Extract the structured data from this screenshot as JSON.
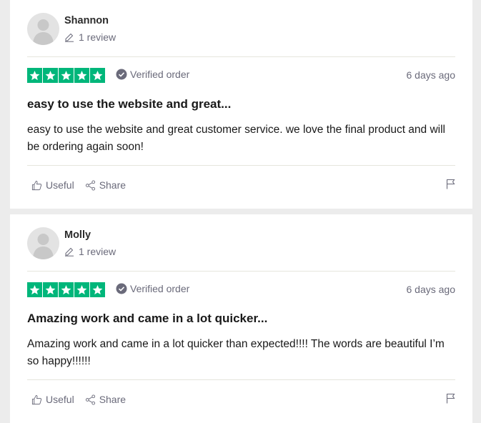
{
  "reviews": [
    {
      "author": "Shannon",
      "review_count": "1 review",
      "verified_label": "Verified order",
      "date": "6 days ago",
      "title": "easy to use the website and great...",
      "body": "easy to use the website and great customer service. we love the final product and will be ordering again soon!",
      "rating": 5,
      "useful_label": "Useful",
      "share_label": "Share"
    },
    {
      "author": "Molly",
      "review_count": "1 review",
      "verified_label": "Verified order",
      "date": "6 days ago",
      "title": "Amazing work and came in a lot quicker...",
      "body": "Amazing work and came in a lot quicker than expected!!!! The words are beautiful I’m so happy!!!!!!",
      "rating": 5,
      "useful_label": "Useful",
      "share_label": "Share"
    }
  ],
  "colors": {
    "star_green": "#00b67a",
    "text_primary": "#191919",
    "text_muted": "#6a6a7a",
    "page_bg": "#ececec"
  },
  "icons": [
    "avatar-placeholder",
    "pencil-icon",
    "star-icon",
    "verified-check-icon",
    "thumbs-up-icon",
    "share-icon",
    "flag-icon"
  ]
}
